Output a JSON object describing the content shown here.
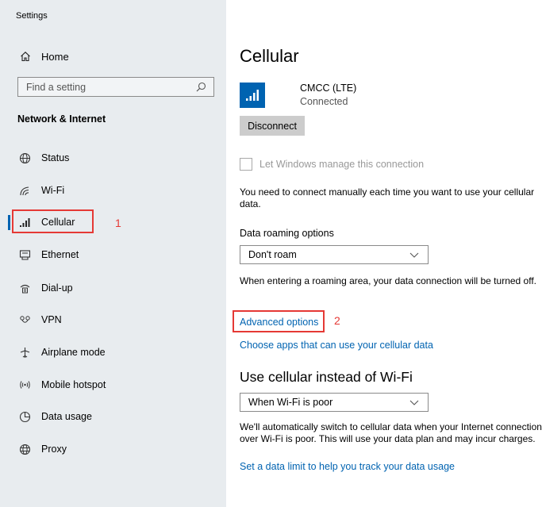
{
  "app": {
    "title": "Settings"
  },
  "sidebar": {
    "home_label": "Home",
    "search_placeholder": "Find a setting",
    "section_title": "Network & Internet",
    "items": [
      {
        "label": "Status",
        "icon": "globe-icon"
      },
      {
        "label": "Wi-Fi",
        "icon": "wifi-icon"
      },
      {
        "label": "Cellular",
        "icon": "cellular-icon",
        "selected": true
      },
      {
        "label": "Ethernet",
        "icon": "ethernet-icon"
      },
      {
        "label": "Dial-up",
        "icon": "dialup-icon"
      },
      {
        "label": "VPN",
        "icon": "vpn-icon"
      },
      {
        "label": "Airplane mode",
        "icon": "airplane-icon"
      },
      {
        "label": "Mobile hotspot",
        "icon": "hotspot-icon"
      },
      {
        "label": "Data usage",
        "icon": "data-usage-icon"
      },
      {
        "label": "Proxy",
        "icon": "proxy-icon"
      }
    ]
  },
  "annotations": {
    "step1": "1",
    "step2": "2",
    "color": "#e53935"
  },
  "main": {
    "title": "Cellular",
    "connection": {
      "name": "CMCC (LTE)",
      "status": "Connected"
    },
    "disconnect_label": "Disconnect",
    "manage_checkbox": {
      "label": "Let Windows manage this connection",
      "checked": false,
      "enabled": false
    },
    "manual_connect_text": "You need to connect manually each time you want to use your cellular data.",
    "roaming": {
      "label": "Data roaming options",
      "selected": "Don't roam",
      "description": "When entering a roaming area, your data connection will be turned off."
    },
    "advanced_options_link": "Advanced options",
    "choose_apps_link": "Choose apps that can use your cellular data",
    "wifi_section": {
      "title": "Use cellular instead of Wi-Fi",
      "selected": "When Wi-Fi is poor",
      "description": "We'll automatically switch to cellular data when your Internet connection over Wi-Fi is poor. This will use your data plan and may incur charges."
    },
    "data_limit_link": "Set a data limit to help you track your data usage"
  },
  "colors": {
    "accent": "#0063b1",
    "sidebar_bg": "#e8ecef",
    "button_bg": "#cccccc"
  }
}
